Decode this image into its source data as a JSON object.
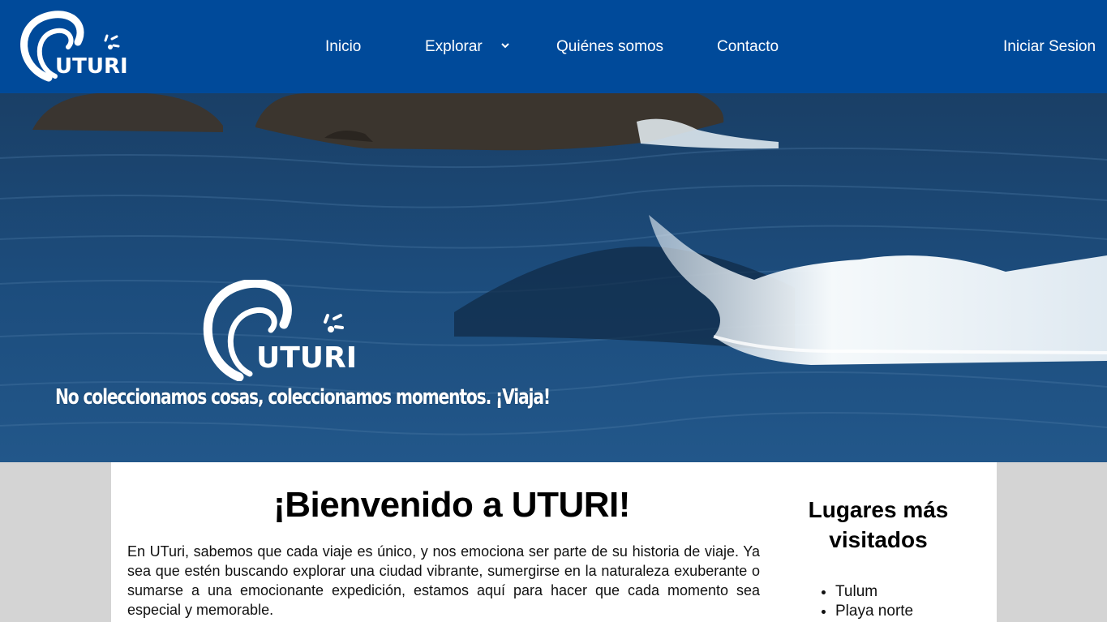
{
  "brand": {
    "name": "UTURI"
  },
  "nav": {
    "items": [
      {
        "label": "Inicio"
      },
      {
        "label": "Explorar"
      },
      {
        "label": "Quiénes somos"
      },
      {
        "label": "Contacto"
      }
    ],
    "login_label": "Iniciar Sesion"
  },
  "hero": {
    "brand": "UTURI",
    "tagline": "No coleccionamos cosas, coleccionamos momentos. ¡Viaja!"
  },
  "main": {
    "title": "¡Bienvenido a UTURI!",
    "intro": "En UTuri, sabemos que cada viaje es único, y nos emociona ser parte de su historia de viaje. Ya sea que estén buscando explorar una ciudad vibrante, sumergirse en la naturaleza exuberante o sumarse a una emocionante expedición, estamos aquí para hacer que cada momento sea especial y memorable."
  },
  "aside": {
    "title": "Lugares más visitados",
    "places": [
      "Tulum",
      "Playa norte"
    ]
  },
  "colors": {
    "header": "#004a9a",
    "page_bg": "#d4d4d4",
    "text": "#ffffff"
  },
  "icons": {
    "dropdown": "chevron-down-icon",
    "logo": "wave-logo-icon"
  }
}
